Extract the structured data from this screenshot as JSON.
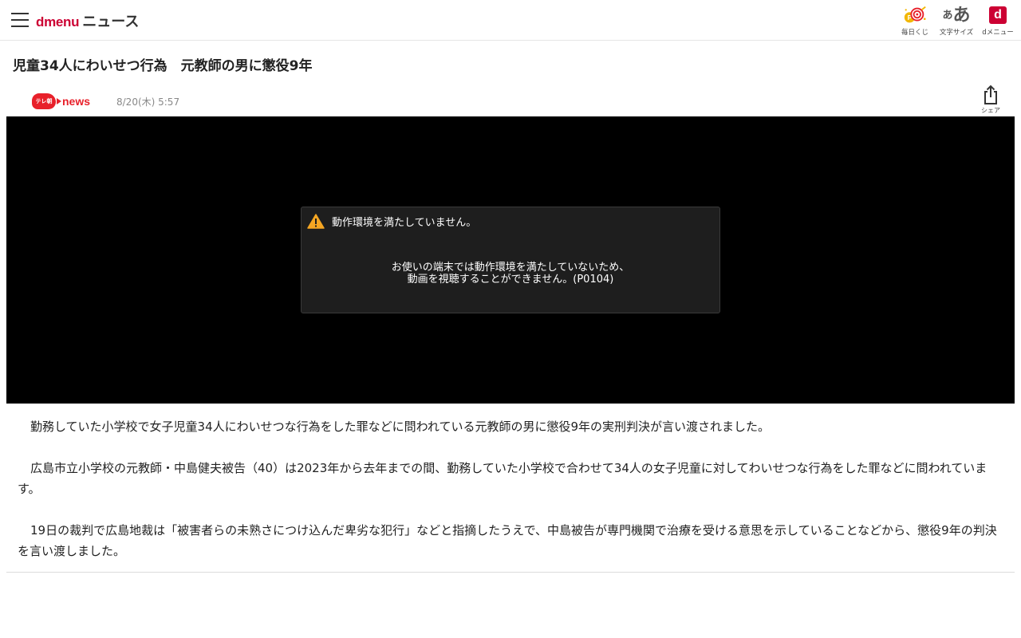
{
  "header": {
    "brand_prefix": "dmenu",
    "brand_name": "ニュース",
    "tools": [
      {
        "label": "毎日くじ",
        "icon": "lottery-target-icon"
      },
      {
        "label": "文字サイズ",
        "icon": "font-size-icon",
        "glyph_small": "あ",
        "glyph_big": "あ"
      },
      {
        "label": "dメニュー",
        "icon": "dmenu-icon",
        "glyph": "d"
      }
    ]
  },
  "article": {
    "title": "児童34人にわいせつ行為　元教師の男に懲役9年",
    "source": {
      "logo_small_text": "テレ朝",
      "logo_text": "news"
    },
    "date": "8/20(木) 5:57",
    "share_label": "シェア",
    "video": {
      "error_title": "動作環境を満たしていません。",
      "error_line1": "お使いの端末では動作環境を満たしていないため、",
      "error_line2": "動画を視聴することができません。(P0104)"
    },
    "paragraphs": [
      "勤務していた小学校で女子児童34人にわいせつな行為をした罪などに問われている元教師の男に懲役9年の実刑判決が言い渡されました。",
      "広島市立小学校の元教師・中島健夫被告（40）は2023年から去年までの間、勤務していた小学校で合わせて34人の女子児童に対してわいせつな行為をした罪などに問われています。",
      "19日の裁判で広島地裁は「被害者らの未熟さにつけ込んだ卑劣な犯行」などと指摘したうえで、中島被告が専門機関で治療を受ける意思を示していることなどから、懲役9年の判決を言い渡しました。"
    ]
  },
  "colors": {
    "brand_red": "#cc0033",
    "news_red": "#e8202a",
    "warning_orange": "#f5a623",
    "lottery_yellow": "#f2b705"
  }
}
